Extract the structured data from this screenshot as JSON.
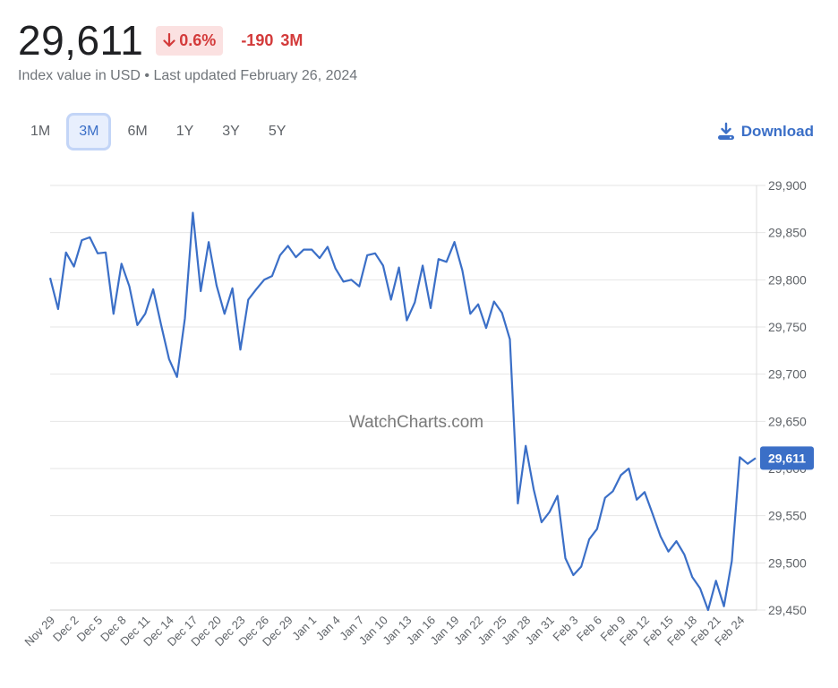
{
  "header": {
    "price": "29,611",
    "change_pct": "0.6%",
    "change_direction": "down",
    "change_abs": "-190",
    "period": "3M",
    "subtitle": "Index value in USD • Last updated February 26, 2024"
  },
  "ranges": [
    {
      "label": "1M",
      "active": false
    },
    {
      "label": "3M",
      "active": true
    },
    {
      "label": "6M",
      "active": false
    },
    {
      "label": "1Y",
      "active": false
    },
    {
      "label": "3Y",
      "active": false
    },
    {
      "label": "5Y",
      "active": false
    }
  ],
  "download_label": "Download",
  "colors": {
    "line": "#3b6fc7",
    "negative": "#d33a3a",
    "negative_bg": "#fbe1e1",
    "accent": "#3b6fc7",
    "grid": "#e6e6e6"
  },
  "chart_data": {
    "type": "line",
    "title": "",
    "xlabel": "",
    "ylabel": "",
    "watermark": "WatchCharts.com",
    "ylim": [
      29450,
      29900
    ],
    "yticks": [
      29450,
      29500,
      29550,
      29600,
      29650,
      29700,
      29750,
      29800,
      29850,
      29900
    ],
    "ytick_labels": [
      "29,450",
      "29,500",
      "29,550",
      "29,600",
      "29,650",
      "29,700",
      "29,750",
      "29,800",
      "29,850",
      "29,900"
    ],
    "xtick_labels": [
      "Nov 29",
      "Dec 2",
      "Dec 5",
      "Dec 8",
      "Dec 11",
      "Dec 14",
      "Dec 17",
      "Dec 20",
      "Dec 23",
      "Dec 26",
      "Dec 29",
      "Jan 1",
      "Jan 4",
      "Jan 7",
      "Jan 10",
      "Jan 13",
      "Jan 16",
      "Jan 19",
      "Jan 22",
      "Jan 25",
      "Jan 28",
      "Jan 31",
      "Feb 3",
      "Feb 6",
      "Feb 9",
      "Feb 12",
      "Feb 15",
      "Feb 18",
      "Feb 21",
      "Feb 24"
    ],
    "xtick_interval_days": 3,
    "grid": true,
    "last_value_label": "29,611",
    "series": [
      {
        "name": "Index value",
        "start_date": "Nov 29",
        "interval": "daily",
        "values": [
          29802,
          29769,
          29829,
          29814,
          29842,
          29845,
          29828,
          29829,
          29764,
          29817,
          29793,
          29752,
          29764,
          29790,
          29752,
          29716,
          29697,
          29759,
          29871,
          29788,
          29840,
          29794,
          29764,
          29791,
          29726,
          29779,
          29790,
          29800,
          29804,
          29826,
          29836,
          29824,
          29832,
          29832,
          29823,
          29835,
          29812,
          29798,
          29800,
          29793,
          29826,
          29828,
          29815,
          29779,
          29813,
          29757,
          29776,
          29815,
          29770,
          29822,
          29819,
          29840,
          29810,
          29764,
          29774,
          29749,
          29777,
          29765,
          29737,
          29563,
          29624,
          29578,
          29543,
          29554,
          29571,
          29505,
          29487,
          29496,
          29525,
          29536,
          29569,
          29576,
          29593,
          29600,
          29567,
          29575,
          29552,
          29528,
          29512,
          29523,
          29509,
          29485,
          29473,
          29450,
          29481,
          29454,
          29502,
          29612,
          29605,
          29611
        ]
      }
    ]
  }
}
